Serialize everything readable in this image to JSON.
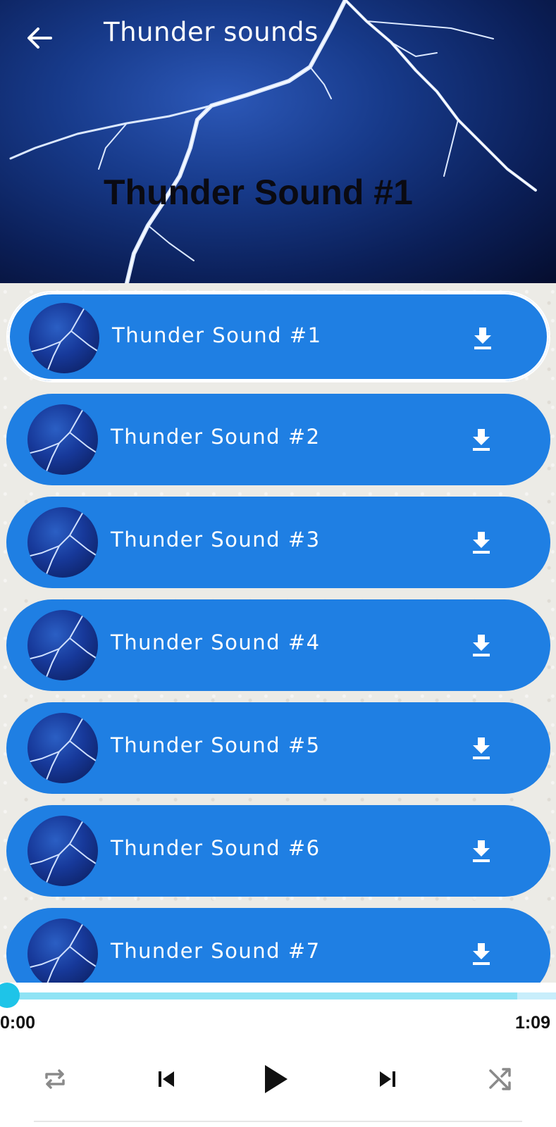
{
  "header": {
    "app_title": "Thunder sounds",
    "now_playing": "Thunder Sound #1",
    "back_icon": "arrow-left-icon"
  },
  "tracks": [
    {
      "label": "Thunder Sound #1",
      "selected": true
    },
    {
      "label": "Thunder Sound #2",
      "selected": false
    },
    {
      "label": "Thunder Sound #3",
      "selected": false
    },
    {
      "label": "Thunder Sound #4",
      "selected": false
    },
    {
      "label": "Thunder Sound #5",
      "selected": false
    },
    {
      "label": "Thunder Sound #6",
      "selected": false
    },
    {
      "label": "Thunder Sound #7",
      "selected": false
    }
  ],
  "player": {
    "elapsed": "0:00",
    "total": "1:09",
    "progress": 0.0,
    "buffered": 0.93,
    "controls": [
      "repeat-icon",
      "skip-previous-icon",
      "play-icon",
      "skip-next-icon",
      "shuffle-icon"
    ]
  },
  "colors": {
    "item_background": "#1f7fe3",
    "progress_thumb": "#1ec4e8",
    "progress_track": "#c8eefb"
  }
}
